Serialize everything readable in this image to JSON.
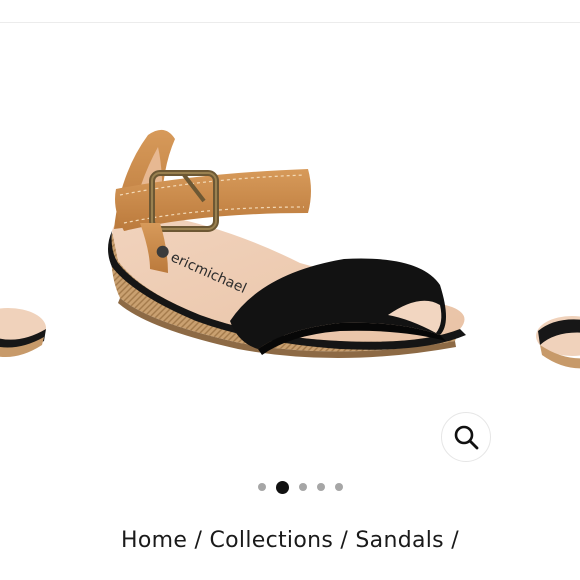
{
  "gallery": {
    "slide_count": 5,
    "active_index": 1,
    "product_brand": "ericmichael",
    "zoom_icon": "magnifier-icon"
  },
  "breadcrumb": {
    "items": [
      "Home",
      "Collections",
      "Sandals"
    ],
    "separator": "/"
  },
  "colors": {
    "accent": "#111111",
    "dot_inactive": "#a6a6a6",
    "strap_tan": "#c98a4b",
    "suede_black": "#121212"
  }
}
